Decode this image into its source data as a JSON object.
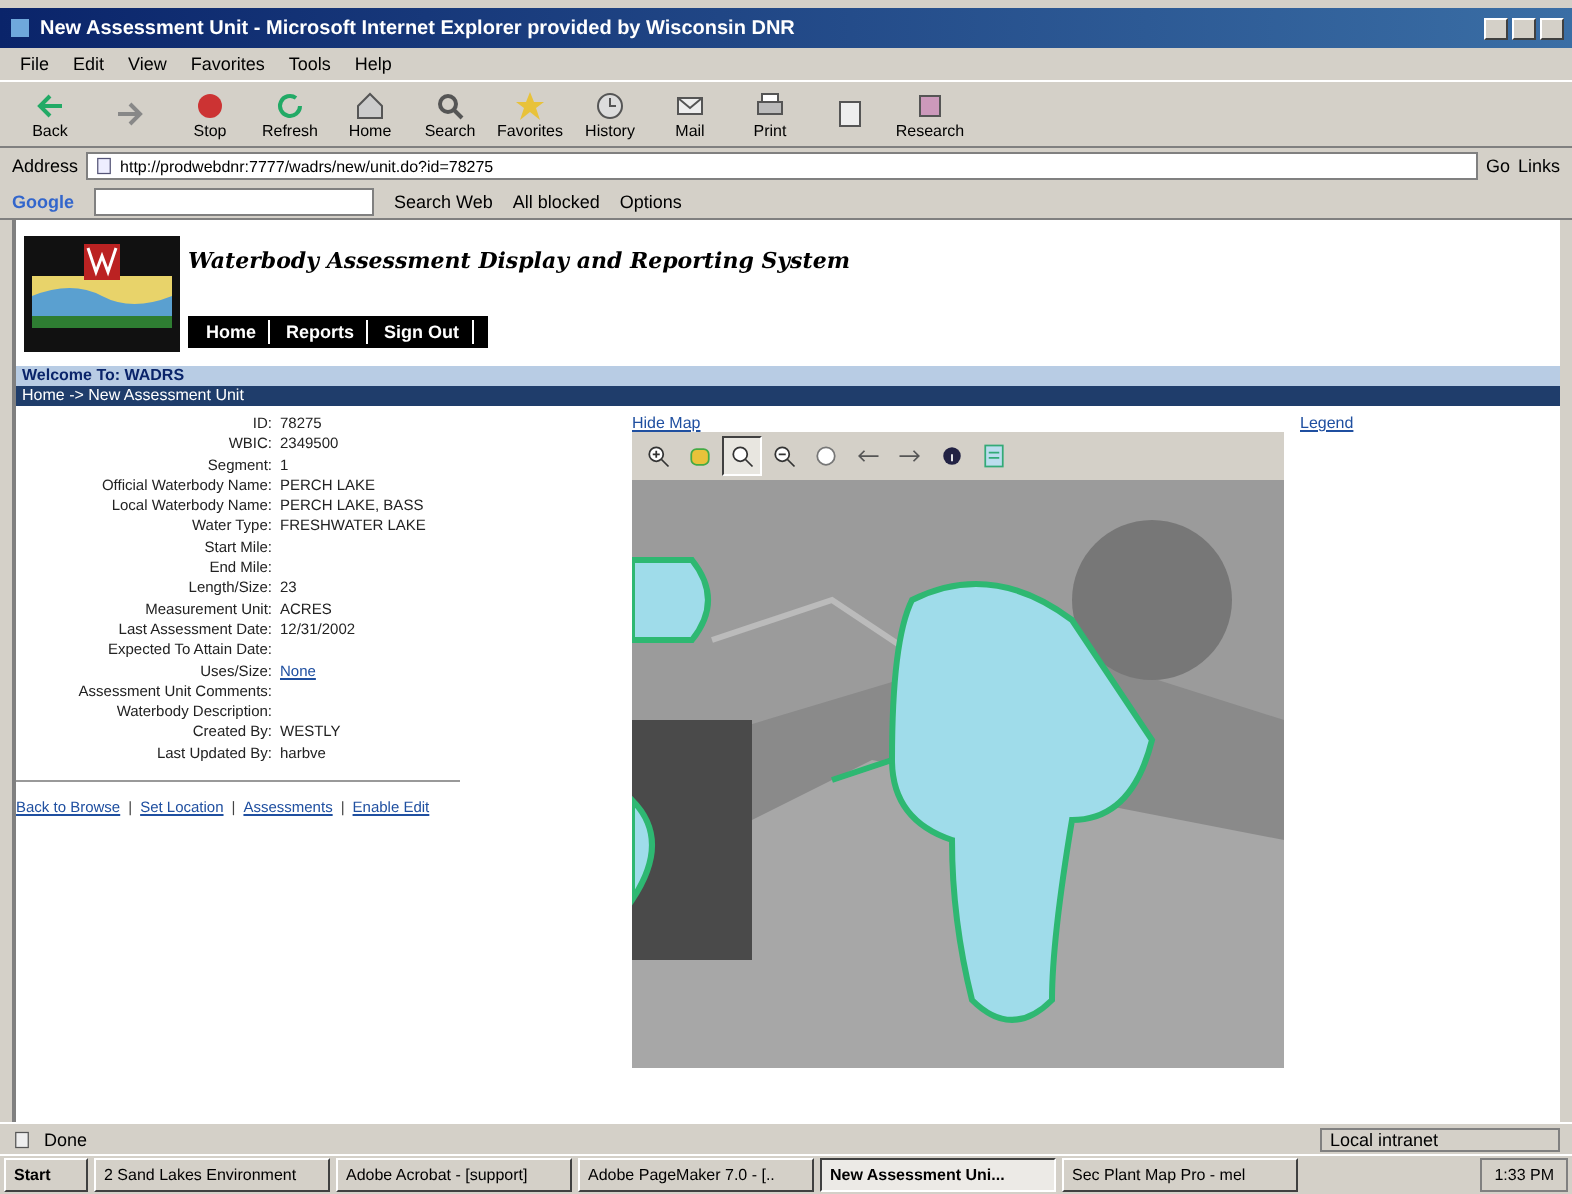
{
  "window": {
    "title": "New Assessment Unit - Microsoft Internet Explorer provided by Wisconsin DNR"
  },
  "menu": [
    "File",
    "Edit",
    "View",
    "Favorites",
    "Tools",
    "Help"
  ],
  "toolbar": [
    {
      "kind": "back",
      "label": "Back"
    },
    {
      "kind": "forward"
    },
    {
      "kind": "stop",
      "label": "Stop"
    },
    {
      "kind": "refresh",
      "label": "Refresh"
    },
    {
      "kind": "home",
      "label": "Home"
    },
    {
      "kind": "search",
      "label": "Search"
    },
    {
      "kind": "favorites",
      "label": "Favorites"
    },
    {
      "kind": "history",
      "label": "History"
    },
    {
      "kind": "mail",
      "label": "Mail"
    },
    {
      "kind": "print",
      "label": "Print"
    },
    {
      "kind": "edit"
    },
    {
      "kind": "research",
      "label": "Research"
    }
  ],
  "address": {
    "label": "Address",
    "value": "http://prodwebdnr:7777/wadrs/new/unit.do?id=78275",
    "go": "Go",
    "links": "Links"
  },
  "google_bar": {
    "logo": "Google",
    "search": "Search Web",
    "blocked": "All blocked",
    "options": "Options"
  },
  "site": {
    "title": "Waterbody Assessment Display and Reporting System",
    "nav": [
      "Home",
      "Reports",
      "Sign Out"
    ],
    "welcome": "Welcome To: WADRS",
    "breadcrumb": "Home -> New Assessment Unit"
  },
  "fields": [
    {
      "label": "ID:",
      "value": "78275"
    },
    {
      "label": "WBIC:",
      "value": "2349500"
    },
    {
      "label": "Segment:",
      "value": "1"
    },
    {
      "label": "Official Waterbody Name:",
      "value": "PERCH LAKE"
    },
    {
      "label": "Local Waterbody Name:",
      "value": "PERCH LAKE, BASS"
    },
    {
      "label": "Water Type:",
      "value": "FRESHWATER LAKE"
    },
    {
      "label": "Start Mile:"
    },
    {
      "label": "End Mile:"
    },
    {
      "label": "Length/Size:",
      "value": "23"
    },
    {
      "label": "Measurement Unit:",
      "value": "ACRES"
    },
    {
      "label": "Last Assessment Date:",
      "value": "12/31/2002"
    },
    {
      "label": "Expected To Attain Date:"
    },
    {
      "label": "Uses/Size:",
      "value": "None",
      "kind": "link"
    },
    {
      "label": "Assessment Unit Comments:"
    },
    {
      "label": "Waterbody Description:"
    },
    {
      "label": "Created By:",
      "value": "WESTLY"
    },
    {
      "label": "Last Updated By:",
      "value": "harbve"
    }
  ],
  "links": [
    {
      "kind": "link",
      "text": "Back to Browse"
    },
    {
      "kind": "separator",
      "text": "|"
    },
    {
      "kind": "link",
      "text": "Set Location"
    },
    {
      "kind": "separator",
      "text": "|"
    },
    {
      "kind": "link",
      "text": "Assessments"
    },
    {
      "kind": "separator",
      "text": "|"
    },
    {
      "kind": "link",
      "text": "Enable Edit"
    }
  ],
  "map": {
    "hide": "Hide Map",
    "legend": "Legend",
    "tools": [
      {
        "kind": "zoom-in",
        "selected": false
      },
      {
        "kind": "pan",
        "selected": false
      },
      {
        "kind": "zoom-box",
        "selected": true
      },
      {
        "kind": "zoom-out",
        "selected": false
      },
      {
        "kind": "extent",
        "selected": false
      },
      {
        "kind": "back",
        "selected": false
      },
      {
        "kind": "forward",
        "selected": false
      },
      {
        "kind": "info",
        "selected": false
      },
      {
        "kind": "layers",
        "selected": false
      }
    ]
  },
  "status_bar": {
    "text": "Done",
    "zone": "Local intranet"
  },
  "taskbar": {
    "start": "Start",
    "items": [
      {
        "label": "2 Sand Lakes Environment",
        "selected": false
      },
      {
        "label": "Adobe Acrobat - [support]",
        "selected": false
      },
      {
        "label": "Adobe PageMaker 7.0 - [..",
        "selected": false
      },
      {
        "label": "New Assessment Uni...",
        "selected": true
      },
      {
        "label": "Sec Plant Map Pro - mel",
        "selected": false
      }
    ],
    "clock": "1:33 PM"
  }
}
